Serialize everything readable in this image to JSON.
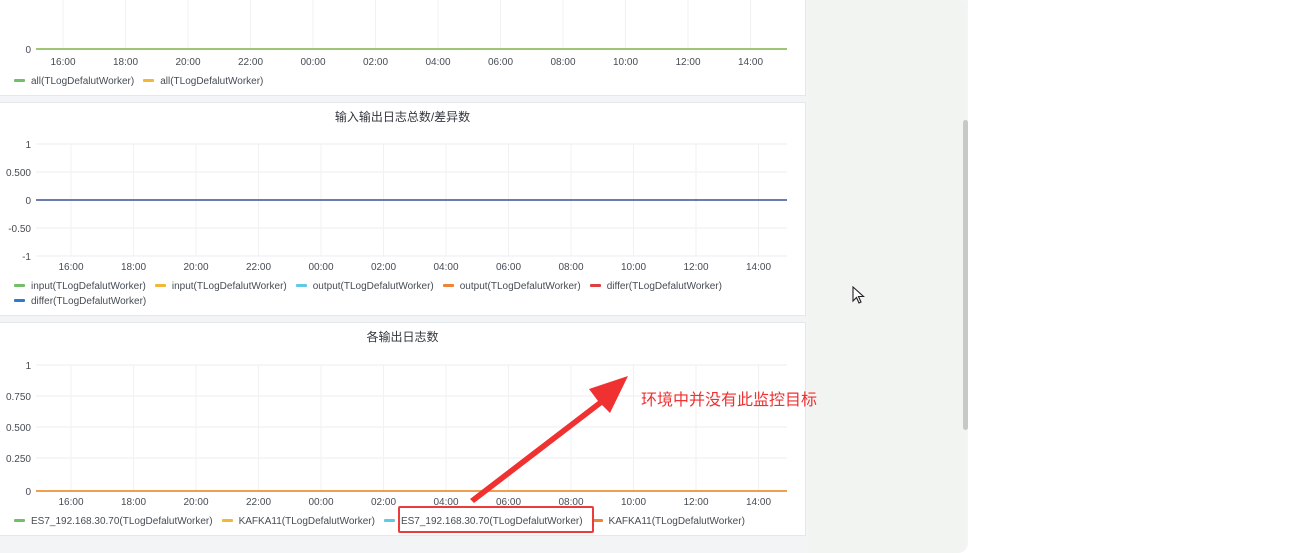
{
  "colors": {
    "green": "#73bf69",
    "yellow": "#f2b736",
    "cyan": "#5fcae5",
    "orange": "#ee8437",
    "red": "#e03f3f",
    "blue": "#2f7ad1",
    "annotation": "#ef3131"
  },
  "panels": [
    {
      "title": "",
      "y_ticks": [
        "0"
      ],
      "x_ticks": [
        "16:00",
        "18:00",
        "20:00",
        "22:00",
        "00:00",
        "02:00",
        "04:00",
        "06:00",
        "08:00",
        "10:00",
        "12:00",
        "14:00"
      ],
      "legend": [
        {
          "label": "all(TLogDefalutWorker)",
          "color": "green"
        },
        {
          "label": "all(TLogDefalutWorker)",
          "color": "yellow"
        }
      ]
    },
    {
      "title": "输入输出日志总数/差异数",
      "y_ticks": [
        "1",
        "0.500",
        "0",
        "-0.50",
        "-1"
      ],
      "x_ticks": [
        "16:00",
        "18:00",
        "20:00",
        "22:00",
        "00:00",
        "02:00",
        "04:00",
        "06:00",
        "08:00",
        "10:00",
        "12:00",
        "14:00"
      ],
      "legend": [
        {
          "label": "input(TLogDefalutWorker)",
          "color": "green"
        },
        {
          "label": "input(TLogDefalutWorker)",
          "color": "yellow"
        },
        {
          "label": "output(TLogDefalutWorker)",
          "color": "cyan"
        },
        {
          "label": "output(TLogDefalutWorker)",
          "color": "orange"
        },
        {
          "label": "differ(TLogDefalutWorker)",
          "color": "red"
        },
        {
          "label": "differ(TLogDefalutWorker)",
          "color": "blue"
        }
      ]
    },
    {
      "title": "各输出日志数",
      "y_ticks": [
        "1",
        "0.750",
        "0.500",
        "0.250",
        "0"
      ],
      "x_ticks": [
        "16:00",
        "18:00",
        "20:00",
        "22:00",
        "00:00",
        "02:00",
        "04:00",
        "06:00",
        "08:00",
        "10:00",
        "12:00",
        "14:00"
      ],
      "legend": [
        {
          "label": "ES7_192.168.30.70(TLogDefalutWorker)",
          "color": "green"
        },
        {
          "label": "KAFKA11(TLogDefalutWorker)",
          "color": "yellow"
        },
        {
          "label": "ES7_192.168.30.70(TLogDefalutWorker)",
          "color": "cyan"
        },
        {
          "label": "KAFKA11(TLogDefalutWorker)",
          "color": "orange"
        }
      ]
    }
  ],
  "annotation": {
    "text": "环境中并没有此监控目标"
  },
  "icons": {
    "cursor": "mouse-pointer-icon"
  }
}
